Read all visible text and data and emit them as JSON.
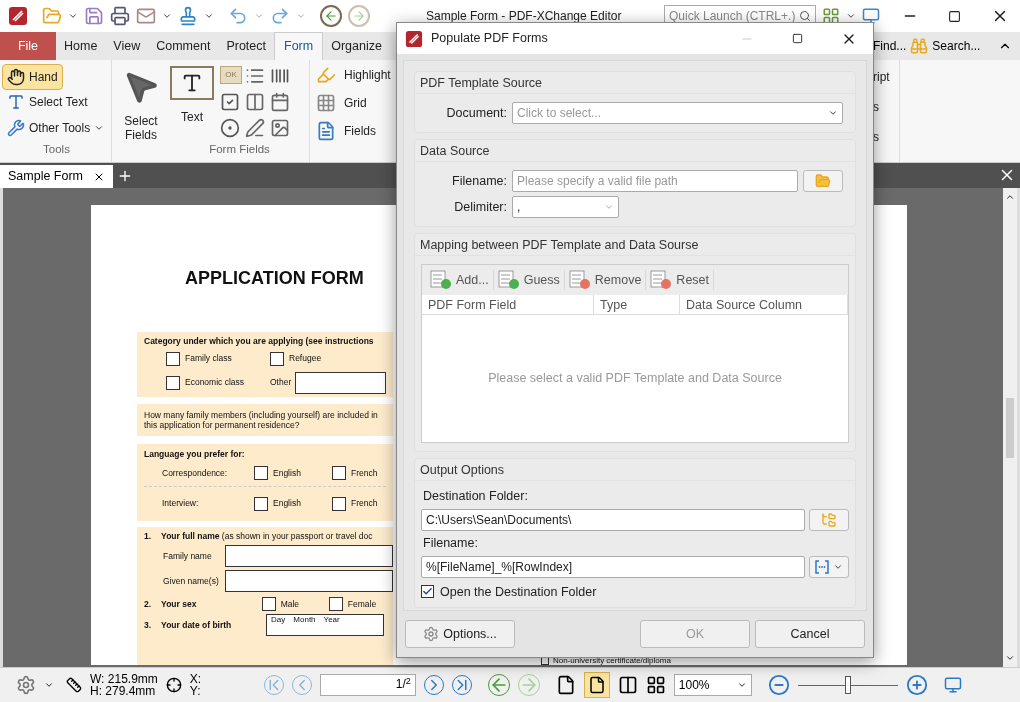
{
  "app_title": "Sample Form - PDF-XChange Editor",
  "quick_launch": {
    "placeholder": "Quick Launch (CTRL+.)"
  },
  "ribbon_tabs": [
    {
      "label": "File",
      "kind": "file",
      "selected": false
    },
    {
      "label": "Home",
      "kind": "tab",
      "selected": false
    },
    {
      "label": "View",
      "kind": "tab",
      "selected": false
    },
    {
      "label": "Comment",
      "kind": "tab",
      "selected": false
    },
    {
      "label": "Protect",
      "kind": "tab",
      "selected": false
    },
    {
      "label": "Form",
      "kind": "tab",
      "selected": true
    },
    {
      "label": "Organize",
      "kind": "tab",
      "selected": false
    }
  ],
  "ribbon_right": {
    "find": "Find...",
    "search": "Search..."
  },
  "tools_group": {
    "title": "Tools",
    "items": [
      {
        "label": "Hand",
        "kind": "hand",
        "selected": true
      },
      {
        "label": "Select Text",
        "kind": "select_text",
        "selected": false
      },
      {
        "label": "Other Tools",
        "kind": "other",
        "selected": false
      }
    ]
  },
  "select_fields": "Select Fields",
  "form_fields_group": {
    "title": "Form Fields",
    "text_tool": "Text",
    "button_tool": "OK"
  },
  "form_tools": [
    {
      "label": "Highlight",
      "kind": "highlight"
    },
    {
      "label": "Grid",
      "kind": "grid"
    },
    {
      "label": "Fields",
      "kind": "fields"
    }
  ],
  "cut_items": [
    "ript",
    "s",
    "s"
  ],
  "doc_tab": {
    "label": "Sample Form"
  },
  "document": {
    "title": "APPLICATION FORM",
    "category": {
      "heading": "Category under which you are applying (see instructions",
      "options": [
        {
          "label": "Family class",
          "checked": false
        },
        {
          "label": "Refugee",
          "checked": false
        },
        {
          "label": "Economic class",
          "checked": false
        }
      ],
      "other": "Other"
    },
    "question": "How many family members (including yourself) are included in this application for permanent residence?",
    "language": {
      "heading": "Language you prefer for:",
      "rows": [
        {
          "label": "Correspondence:",
          "options": [
            {
              "label": "English",
              "checked": false
            },
            {
              "label": "French",
              "checked": false
            }
          ]
        },
        {
          "label": "Interview:",
          "options": [
            {
              "label": "English",
              "checked": false
            },
            {
              "label": "French",
              "checked": false
            }
          ]
        }
      ]
    },
    "name": {
      "number": "1.",
      "title": "**Your full name** (as shown in your passport or travel doc",
      "fields": [
        "Family name",
        "Given name(s)"
      ]
    },
    "sex": {
      "number": "2.",
      "title": "Your sex",
      "options": [
        {
          "label": "Male",
          "checked": false
        },
        {
          "label": "Female",
          "checked": false
        }
      ]
    },
    "birth": {
      "number": "3.",
      "title": "Your date of birth",
      "parts": [
        "Day",
        "Month",
        "Year"
      ]
    },
    "bottom_option": {
      "label": "Non-university certificate/diploma",
      "checked": false
    }
  },
  "dialog": {
    "title": "Populate PDF Forms",
    "template": {
      "heading": "PDF Template Source",
      "label": "Document:",
      "placeholder": "Click to select..."
    },
    "data_source": {
      "heading": "Data Source",
      "filename_label": "Filename:",
      "filename_placeholder": "Please specify a valid file path",
      "delimiter_label": "Delimiter:",
      "delimiter": ","
    },
    "mapping": {
      "heading": "Mapping between PDF Template and Data Sourse",
      "tools": [
        {
          "label": "Add...",
          "kind": "add"
        },
        {
          "label": "Guess",
          "kind": "guess"
        },
        {
          "label": "Remove",
          "kind": "remove"
        },
        {
          "label": "Reset",
          "kind": "reset"
        }
      ],
      "columns": [
        "PDF Form Field",
        "Type",
        "Data Source Column"
      ],
      "empty": "Please select a valid PDF Template and Data Source"
    },
    "output": {
      "heading": "Output Options",
      "folder_label": "Destination Folder:",
      "folder": "C:\\Users\\Sean\\Documents\\",
      "filename_label": "Filename:",
      "filename": "%[FileName]_%[RowIndex]",
      "open_folder": {
        "label": "Open the Destination Folder",
        "checked": true
      }
    },
    "buttons": [
      {
        "label": "Options...",
        "kind": "options",
        "disabled": false
      },
      {
        "label": "OK",
        "kind": "ok",
        "disabled": true
      },
      {
        "label": "Cancel",
        "kind": "cancel",
        "disabled": false
      }
    ]
  },
  "status": {
    "width": "W: 215.9mm",
    "height": "H: 279.4mm",
    "x": "X:",
    "y": "Y:",
    "page": "1/$^{2}$",
    "zoom": "100%",
    "zoom_slider": {
      "level": 0.5
    }
  }
}
